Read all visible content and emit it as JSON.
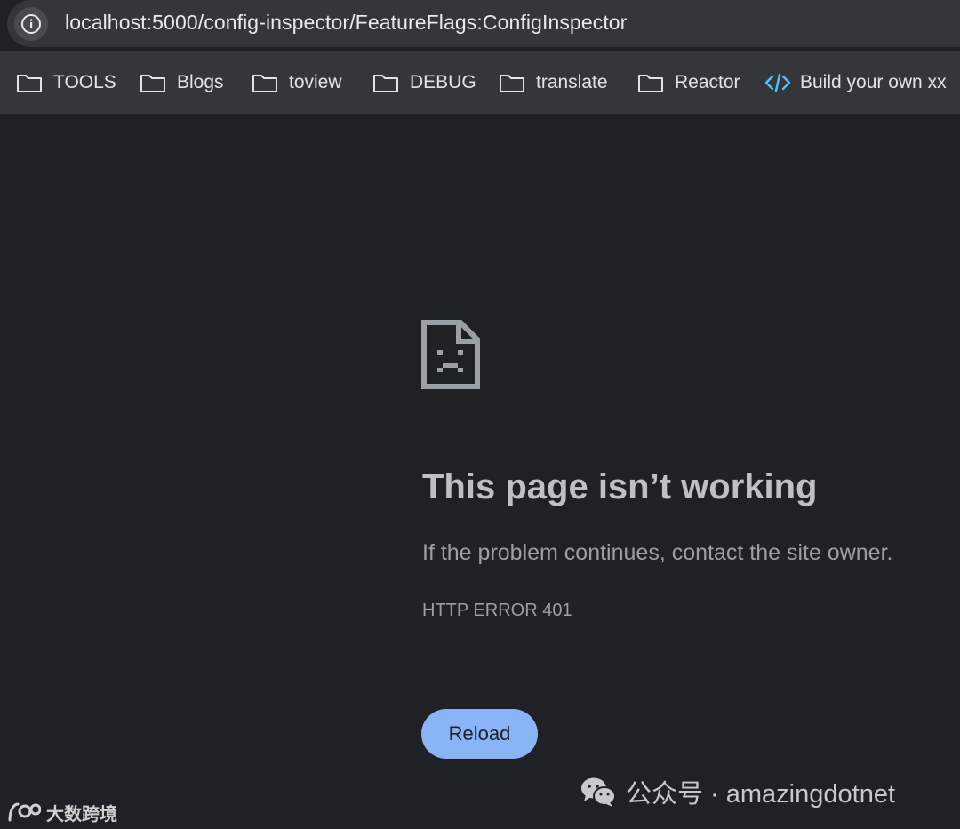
{
  "address_bar": {
    "url": "localhost:5000/config-inspector/FeatureFlags:ConfigInspector",
    "info_icon": "info-icon"
  },
  "bookmarks": [
    {
      "label": "TOOLS",
      "icon": "folder-icon"
    },
    {
      "label": "Blogs",
      "icon": "folder-icon"
    },
    {
      "label": "toview",
      "icon": "folder-icon"
    },
    {
      "label": "DEBUG",
      "icon": "folder-icon"
    },
    {
      "label": "translate",
      "icon": "folder-icon"
    },
    {
      "label": "Reactor",
      "icon": "folder-icon"
    },
    {
      "label": "Build your own xx",
      "icon": "code-icon"
    }
  ],
  "error_page": {
    "icon": "sad-page-icon",
    "title": "This page isn’t working",
    "message": "If the problem continues, contact the site owner.",
    "code": "HTTP ERROR 401",
    "reload_label": "Reload"
  },
  "watermarks": {
    "right_text": "公众号 · amazingdotnet",
    "left_text": "大数跨境"
  },
  "colors": {
    "background": "#202124",
    "toolbar": "#35363a",
    "accent_button": "#8ab4f8",
    "code_icon": "#4fc3f7"
  }
}
